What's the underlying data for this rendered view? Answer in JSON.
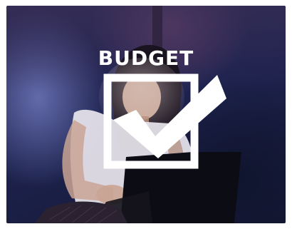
{
  "overlay": {
    "headline": "BUDGET"
  },
  "colors": {
    "overlay_white": "#ffffff",
    "background_navy": "#1e2350",
    "glow_blue": "#7882c8",
    "glow_mauve": "#8c5078"
  },
  "icons": {
    "checkbox": "checkbox-checked-icon"
  },
  "photo": {
    "subject": "woman-with-laptop"
  }
}
